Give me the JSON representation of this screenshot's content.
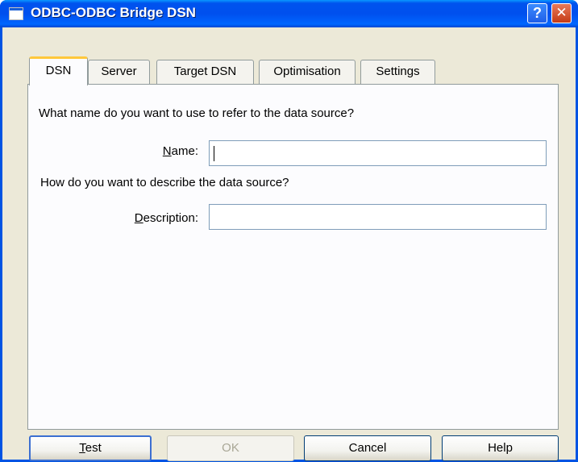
{
  "window": {
    "title": "ODBC-ODBC Bridge DSN",
    "help_symbol": "?",
    "close_symbol": "✕"
  },
  "tabs": [
    {
      "label": "DSN",
      "active": true
    },
    {
      "label": "Server",
      "active": false
    },
    {
      "label": "Target DSN",
      "active": false
    },
    {
      "label": "Optimisation",
      "active": false
    },
    {
      "label": "Settings",
      "active": false
    }
  ],
  "dsn": {
    "name_question": "What name do you want to use to refer to the data source?",
    "name_label_mnemonic": "N",
    "name_label_rest": "ame:",
    "name_value": "",
    "description_question": "How do you want to describe the data source?",
    "description_label_mnemonic": "D",
    "description_label_rest": "escription:",
    "description_value": ""
  },
  "buttons": {
    "test_mnemonic": "T",
    "test_rest": "est",
    "ok": "OK",
    "cancel": "Cancel",
    "help": "Help"
  }
}
